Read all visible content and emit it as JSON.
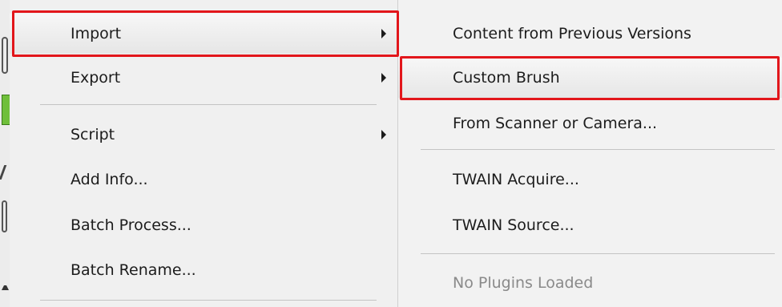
{
  "main_menu": {
    "items": [
      {
        "label": "Import"
      },
      {
        "label": "Export"
      },
      {
        "label": "Script"
      },
      {
        "label": "Add Info..."
      },
      {
        "label": "Batch Process..."
      },
      {
        "label": "Batch Rename..."
      }
    ]
  },
  "submenu": {
    "items": [
      {
        "label": "Content from Previous Versions"
      },
      {
        "label": "Custom Brush"
      },
      {
        "label": "From Scanner or Camera..."
      },
      {
        "label": "TWAIN Acquire..."
      },
      {
        "label": "TWAIN Source..."
      },
      {
        "label": "No Plugins Loaded"
      }
    ]
  },
  "colors": {
    "highlight_outline": "#e2161b",
    "disabled_text": "#8a8a8a",
    "menu_background": "#f0f0f0"
  },
  "icons": [
    "submenu-arrow-icon"
  ]
}
